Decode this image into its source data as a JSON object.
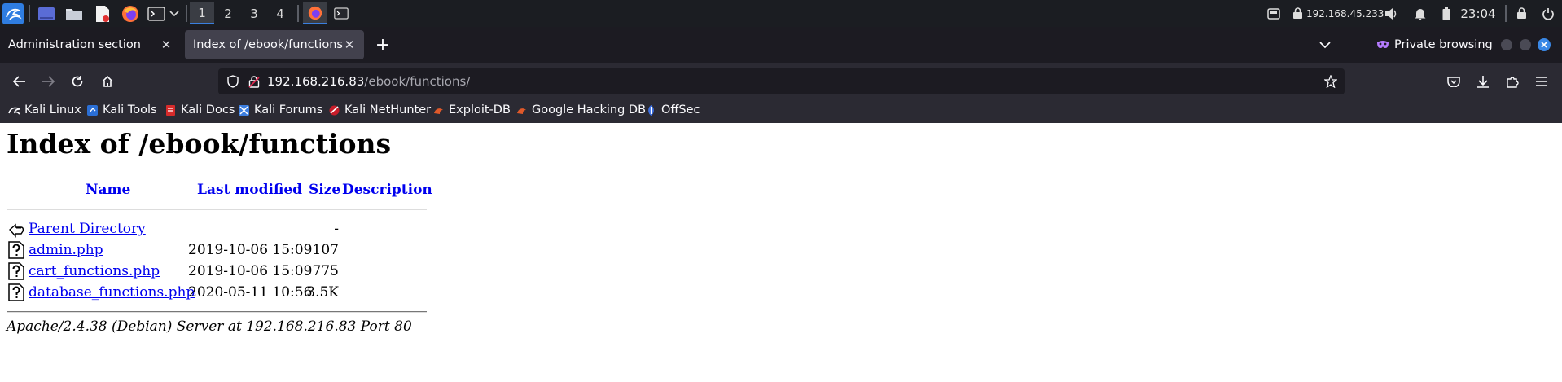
{
  "os_panel": {
    "workspaces": [
      "1",
      "2",
      "3",
      "4"
    ],
    "active_workspace": "1",
    "ip_address": "192.168.45.233",
    "clock": "23:04",
    "icons": [
      "kali-menu-icon",
      "desktop-icon",
      "files-icon",
      "text-editor-icon",
      "firefox-icon",
      "terminal-icon",
      "chevron-down-icon",
      "firefox-window-icon",
      "terminal-window-icon",
      "vpn-icon",
      "lock-network-icon",
      "volume-icon",
      "notification-bell-icon",
      "battery-icon",
      "lock-screen-icon",
      "power-icon"
    ]
  },
  "browser": {
    "tabs": [
      {
        "label": "Administration section",
        "active": false
      },
      {
        "label": "Index of /ebook/functions",
        "active": true
      }
    ],
    "new_tab_label": "+",
    "private_browsing_label": "Private browsing",
    "url": {
      "host": "192.168.216.83",
      "path": "/ebook/functions/"
    },
    "bookmarks": [
      {
        "label": "Kali Linux",
        "icon": "kali-linux-icon"
      },
      {
        "label": "Kali Tools",
        "icon": "kali-tools-icon"
      },
      {
        "label": "Kali Docs",
        "icon": "kali-docs-icon"
      },
      {
        "label": "Kali Forums",
        "icon": "kali-forums-icon"
      },
      {
        "label": "Kali NetHunter",
        "icon": "kali-nethunter-icon"
      },
      {
        "label": "Exploit-DB",
        "icon": "exploit-db-icon"
      },
      {
        "label": "Google Hacking DB",
        "icon": "ghdb-icon"
      },
      {
        "label": "OffSec",
        "icon": "offsec-icon"
      }
    ]
  },
  "page": {
    "title": "Index of /ebook/functions",
    "columns": {
      "name": "Name",
      "last_modified": "Last modified",
      "size": "Size",
      "description": "Description"
    },
    "rows": [
      {
        "name": "Parent Directory",
        "modified": "",
        "size": "-",
        "icon": "back-arrow-icon"
      },
      {
        "name": "admin.php",
        "modified": "2019-10-06 15:09",
        "size": "107",
        "icon": "unknown-file-icon"
      },
      {
        "name": "cart_functions.php",
        "modified": "2019-10-06 15:09",
        "size": "775",
        "icon": "unknown-file-icon"
      },
      {
        "name": "database_functions.php",
        "modified": "2020-05-11 10:56",
        "size": "3.5K",
        "icon": "unknown-file-icon"
      }
    ],
    "address": "Apache/2.4.38 (Debian) Server at 192.168.216.83 Port 80"
  },
  "colors": {
    "panel_bg": "#1b1d22",
    "tabstrip_bg": "#1c1b22",
    "toolbar_bg": "#2b2a33",
    "active_tab_bg": "#42414d",
    "link": "#0000ee",
    "kali_blue": "#3a7fe0"
  }
}
